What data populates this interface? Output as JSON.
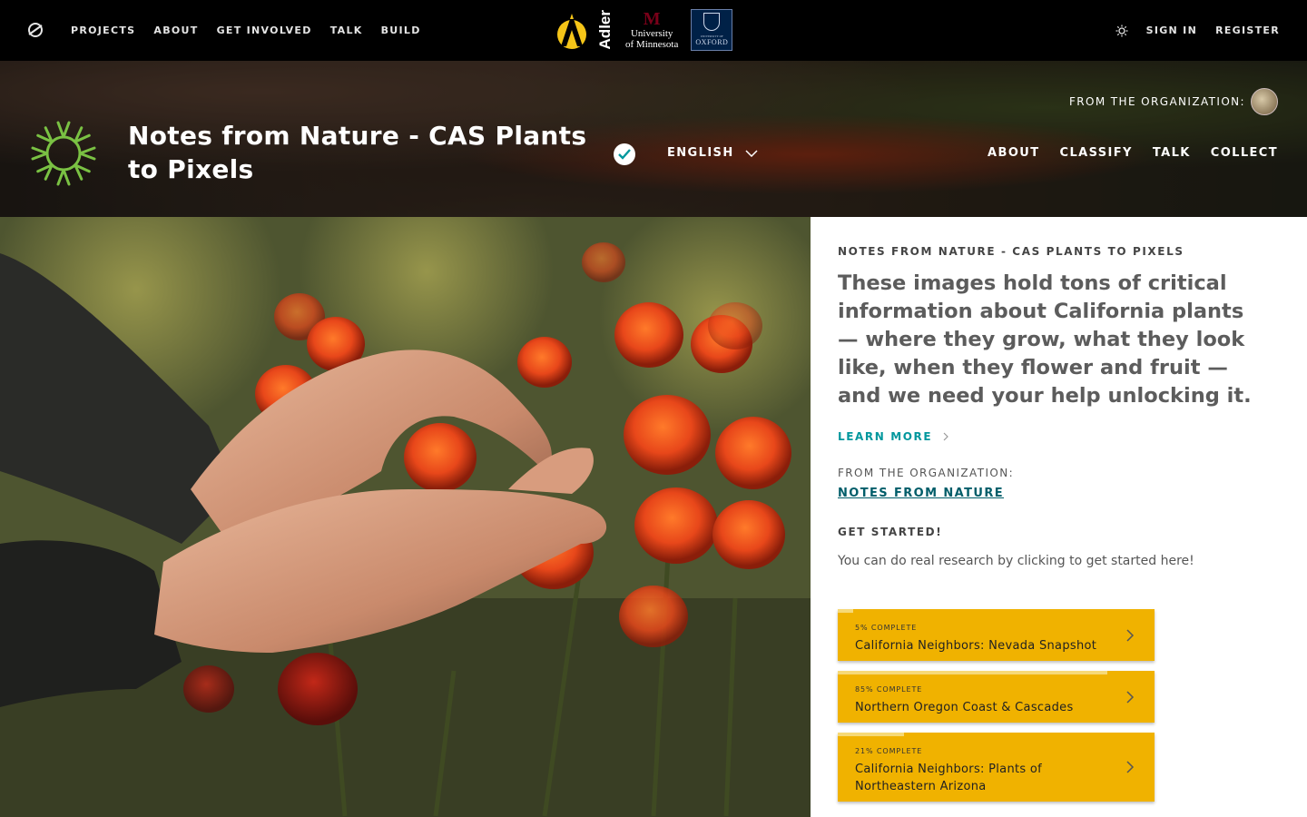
{
  "topnav": {
    "links": [
      "PROJECTS",
      "ABOUT",
      "GET INVOLVED",
      "TALK",
      "BUILD"
    ],
    "sign_in": "SIGN IN",
    "register": "REGISTER",
    "partners": {
      "adler": "Adler",
      "umn_line1": "University",
      "umn_line2": "of Minnesota",
      "oxford_small": "UNIVERSITY OF",
      "oxford": "OXFORD"
    }
  },
  "project": {
    "title": "Notes from Nature - CAS Plants to Pixels",
    "language": "ENGLISH",
    "from_org": "FROM THE ORGANIZATION:",
    "nav": [
      "ABOUT",
      "CLASSIFY",
      "TALK",
      "COLLECT"
    ]
  },
  "info": {
    "kicker": "NOTES FROM NATURE - CAS PLANTS TO PIXELS",
    "intro": "These images hold tons of critical information about California plants — where they grow, what they look like, when they flower and fruit — and we need your help unlocking it.",
    "learn_more": "LEARN MORE",
    "org_label": "FROM THE ORGANIZATION:",
    "org_link": "NOTES FROM NATURE",
    "get_started_label": "GET STARTED!",
    "get_started_text": "You can do real research by clicking to get started here!"
  },
  "workflows": [
    {
      "pct_label": "5% COMPLETE",
      "progress": 0.05,
      "name": "California Neighbors: Nevada Snapshot"
    },
    {
      "pct_label": "85% COMPLETE",
      "progress": 0.85,
      "name": "Northern Oregon Coast & Cascades"
    },
    {
      "pct_label": "21% COMPLETE",
      "progress": 0.21,
      "name": "California Neighbors: Plants of Northeastern Arizona"
    }
  ],
  "colors": {
    "accent_teal": "#00979d",
    "workflow_yellow": "#f0b200",
    "sunburst_green": "#7ac143"
  }
}
